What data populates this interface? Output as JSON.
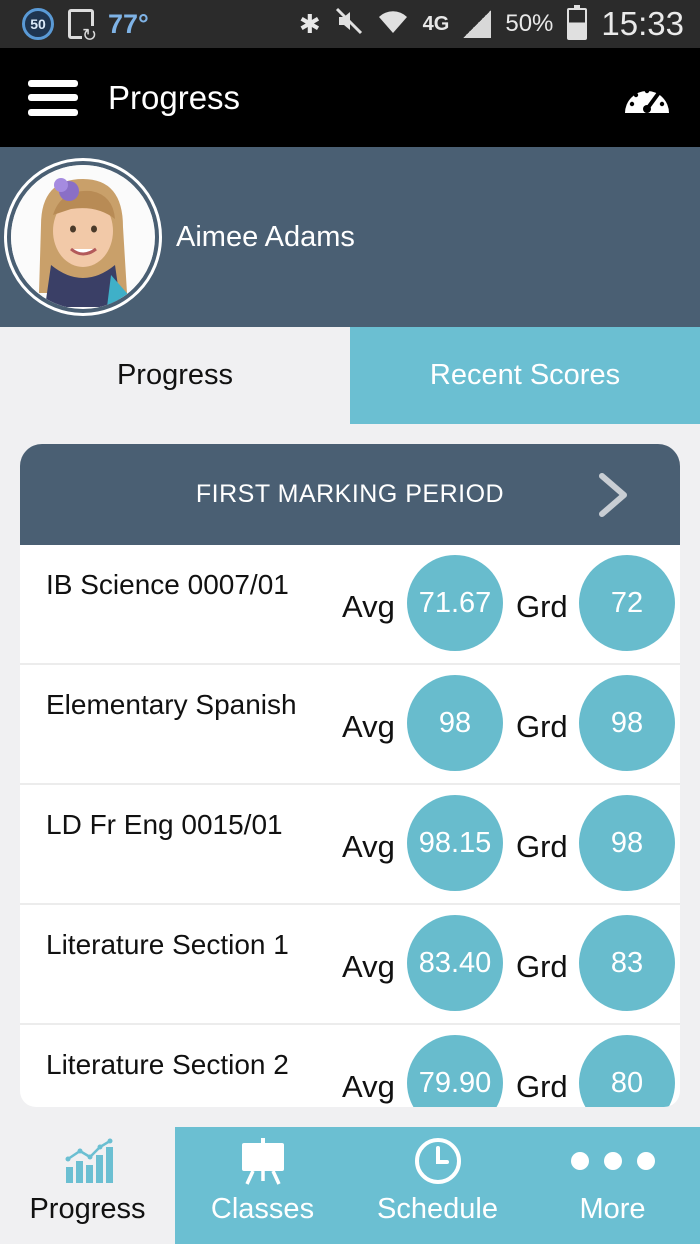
{
  "status_bar": {
    "badge": "50",
    "temperature": "77°",
    "network": "4G",
    "battery": "50%",
    "time": "15:33"
  },
  "app_bar": {
    "title": "Progress",
    "menu_icon": "hamburger-menu-icon",
    "action_icon": "gauge-icon"
  },
  "student": {
    "name": "Aimee Adams",
    "avatar": "student-photo"
  },
  "tabs": [
    {
      "label": "Progress",
      "active": true
    },
    {
      "label": "Recent Scores",
      "active": false
    }
  ],
  "marking_period": {
    "label": "FIRST MARKING PERIOD",
    "next_icon": "chevron-right-icon"
  },
  "courses": [
    {
      "name": "IB Science 0007/01",
      "avg_label": "Avg",
      "avg": "71.67",
      "grd_label": "Grd",
      "grd": "72"
    },
    {
      "name": "Elementary Spanish",
      "avg_label": "Avg",
      "avg": "98",
      "grd_label": "Grd",
      "grd": "98"
    },
    {
      "name": "LD Fr Eng 0015/01",
      "avg_label": "Avg",
      "avg": "98.15",
      "grd_label": "Grd",
      "grd": "98"
    },
    {
      "name": "Literature Section 1",
      "avg_label": "Avg",
      "avg": "83.40",
      "grd_label": "Grd",
      "grd": "83"
    },
    {
      "name": "Literature Section 2",
      "avg_label": "Avg",
      "avg": "79.90",
      "grd_label": "Grd",
      "grd": "80"
    }
  ],
  "bottom_nav": [
    {
      "label": "Progress",
      "icon": "bar-chart-icon",
      "active": true
    },
    {
      "label": "Classes",
      "icon": "easel-icon",
      "active": false
    },
    {
      "label": "Schedule",
      "icon": "clock-icon",
      "active": false
    },
    {
      "label": "More",
      "icon": "more-dots-icon",
      "active": false
    }
  ],
  "colors": {
    "header_slate": "#4a5f73",
    "accent_teal": "#68bccd",
    "app_bar": "#000000",
    "background": "#f0f0f2"
  }
}
